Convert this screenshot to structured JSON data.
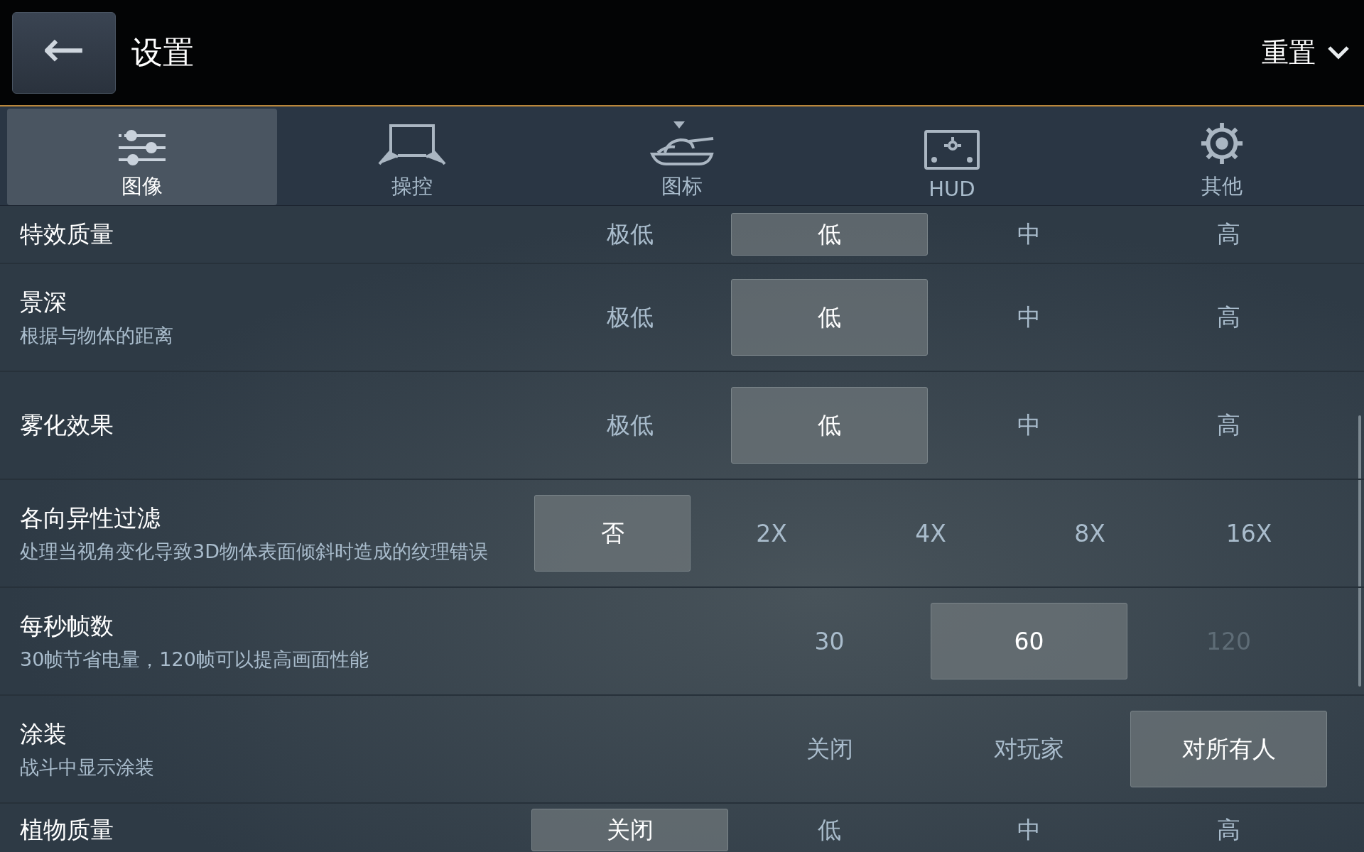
{
  "header": {
    "back_button": "←",
    "title": "设置",
    "reset_menu": "重置"
  },
  "tabs": [
    {
      "label": "图像",
      "selected": true
    },
    {
      "label": "操控",
      "selected": false
    },
    {
      "label": "图标",
      "selected": false
    },
    {
      "label": "HUD",
      "selected": false
    },
    {
      "label": "其他",
      "selected": false
    }
  ],
  "settings": [
    {
      "name": "特效质量",
      "options": [
        {
          "label": "极低",
          "selected": false,
          "disabled": false
        },
        {
          "label": "低",
          "selected": true,
          "disabled": false
        },
        {
          "label": "中",
          "selected": false,
          "disabled": false
        },
        {
          "label": "高",
          "selected": false,
          "disabled": false
        }
      ]
    },
    {
      "name": "景深",
      "description": "根据与物体的距离",
      "options": [
        {
          "label": "极低",
          "selected": false,
          "disabled": false
        },
        {
          "label": "低",
          "selected": true,
          "disabled": false
        },
        {
          "label": "中",
          "selected": false,
          "disabled": false
        },
        {
          "label": "高",
          "selected": false,
          "disabled": false
        }
      ]
    },
    {
      "name": "雾化效果",
      "options": [
        {
          "label": "极低",
          "selected": false,
          "disabled": false
        },
        {
          "label": "低",
          "selected": true,
          "disabled": false
        },
        {
          "label": "中",
          "selected": false,
          "disabled": false
        },
        {
          "label": "高",
          "selected": false,
          "disabled": false
        }
      ]
    },
    {
      "name": "各向异性过滤",
      "description": "处理当视角变化导致3D物体表面倾斜时造成的纹理错误",
      "options": [
        {
          "label": "否",
          "selected": true,
          "disabled": false
        },
        {
          "label": "2X",
          "selected": false,
          "disabled": false
        },
        {
          "label": "4X",
          "selected": false,
          "disabled": false
        },
        {
          "label": "8X",
          "selected": false,
          "disabled": false
        },
        {
          "label": "16X",
          "selected": false,
          "disabled": false
        }
      ]
    },
    {
      "name": "每秒帧数",
      "description": "30帧节省电量，120帧可以提高画面性能",
      "options": [
        {
          "label": "30",
          "selected": false,
          "disabled": false
        },
        {
          "label": "60",
          "selected": true,
          "disabled": false
        },
        {
          "label": "120",
          "selected": false,
          "disabled": true
        }
      ]
    },
    {
      "name": "涂装",
      "description": "战斗中显示涂装",
      "options": [
        {
          "label": "关闭",
          "selected": false,
          "disabled": false
        },
        {
          "label": "对玩家",
          "selected": false,
          "disabled": false
        },
        {
          "label": "对所有人",
          "selected": true,
          "disabled": false
        }
      ]
    },
    {
      "name": "植物质量",
      "options": [
        {
          "label": "关闭",
          "selected": true,
          "disabled": false
        },
        {
          "label": "低",
          "selected": false,
          "disabled": false
        },
        {
          "label": "中",
          "selected": false,
          "disabled": false
        },
        {
          "label": "高",
          "selected": false,
          "disabled": false
        }
      ]
    }
  ]
}
